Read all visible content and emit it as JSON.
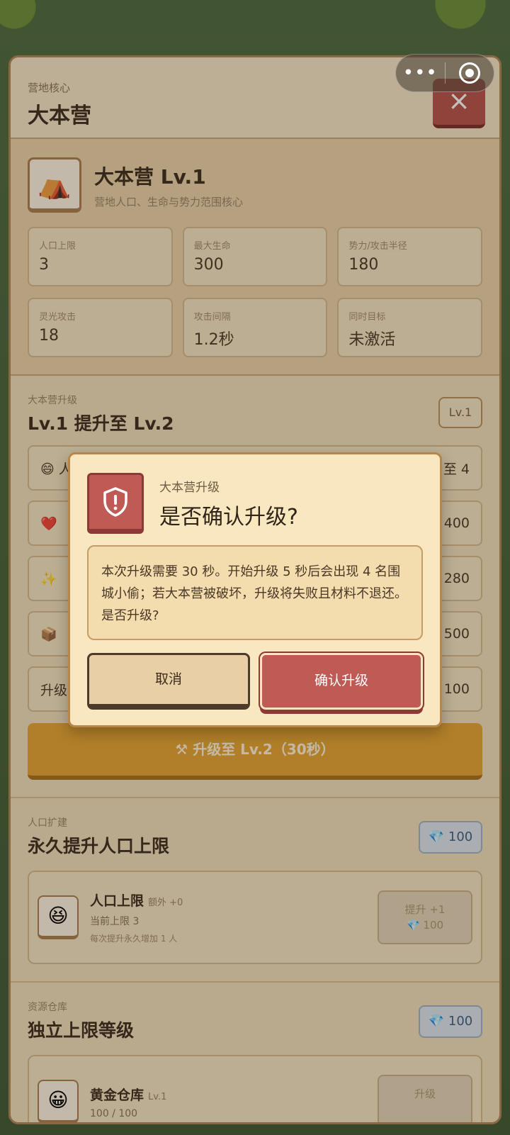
{
  "panel": {
    "subtitle": "营地核心",
    "title": "大本营",
    "close_label": "×"
  },
  "building": {
    "icon": "⛺",
    "name": "大本营 Lv.1",
    "desc": "营地人口、生命与势力范围核心",
    "stats": [
      {
        "label": "人口上限",
        "value": "3"
      },
      {
        "label": "最大生命",
        "value": "300"
      },
      {
        "label": "势力/攻击半径",
        "value": "180"
      },
      {
        "label": "灵光攻击",
        "value": "18"
      },
      {
        "label": "攻击间隔",
        "value": "1.2秒"
      },
      {
        "label": "同时目标",
        "value": "未激活"
      }
    ]
  },
  "upgrade": {
    "subtitle": "大本营升级",
    "title": "Lv.1 提升至 Lv.2",
    "badge": "Lv.1",
    "rows": [
      {
        "icon": "😄",
        "left": "人",
        "right": "至 4"
      },
      {
        "icon": "❤️",
        "left": "",
        "right": "400"
      },
      {
        "icon": "✨",
        "left": "",
        "right": "280"
      },
      {
        "icon": "📦",
        "left": "",
        "right": "500"
      },
      {
        "icon": "",
        "left": "升级",
        "right": "/ 100"
      }
    ],
    "button": "⚒ 升级至 Lv.2（30秒）"
  },
  "population": {
    "subtitle": "人口扩建",
    "title": "永久提升人口上限",
    "cost": "💎 100",
    "card": {
      "icon": "😆",
      "name": "人口上限",
      "extra": "额外 +0",
      "line": "当前上限 3",
      "tiny": "每次提升永久增加 1 人",
      "btn_line1": "提升 +1",
      "btn_line2": "💎 100"
    }
  },
  "storage": {
    "subtitle": "资源仓库",
    "title": "独立上限等级",
    "cost": "💎 100",
    "card": {
      "icon": "😀",
      "name": "黄金仓库",
      "extra": "Lv.1",
      "line": "100 / 100",
      "btn": "升级"
    }
  },
  "capsule": {
    "more": "•••"
  },
  "modal": {
    "subtitle": "大本营升级",
    "title": "是否确认升级?",
    "body": "本次升级需要 30 秒。开始升级 5 秒后会出现 4 名围城小偷；若大本营被破坏，升级将失败且材料不退还。是否升级?",
    "cancel": "取消",
    "confirm": "确认升级"
  }
}
